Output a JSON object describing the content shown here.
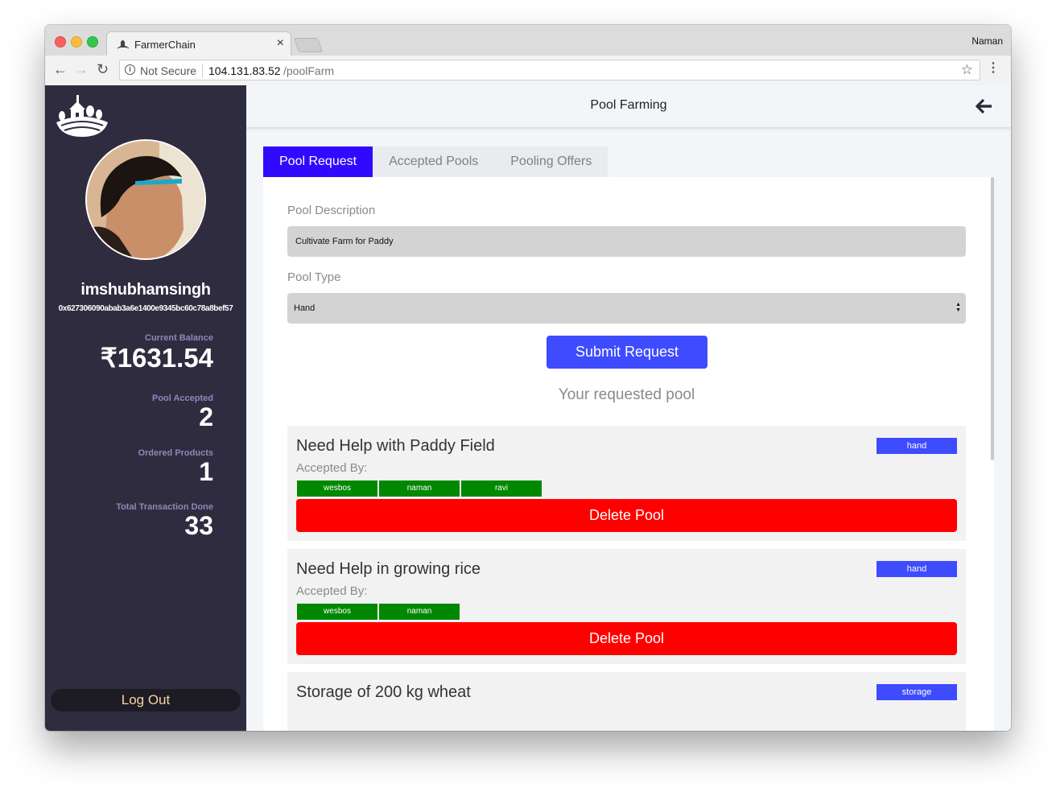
{
  "browser": {
    "tab_title": "FarmerChain",
    "profile_name": "Naman",
    "not_secure": "Not Secure",
    "url_host": "104.131.83.52",
    "url_path": "/poolFarm"
  },
  "sidebar": {
    "username": "imshubhamsingh",
    "address": "0x627306090abab3a6e1400e9345bc60c78a8bef57",
    "stats": [
      {
        "label": "Current Balance",
        "value": "₹1631.54"
      },
      {
        "label": "Pool Accepted",
        "value": "2"
      },
      {
        "label": "Ordered Products",
        "value": "1"
      },
      {
        "label": "Total Transaction Done",
        "value": "33"
      }
    ],
    "logout_label": "Log Out"
  },
  "header": {
    "title": "Pool Farming"
  },
  "tabs": [
    {
      "label": "Pool Request",
      "active": true
    },
    {
      "label": "Accepted Pools",
      "active": false
    },
    {
      "label": "Pooling Offers",
      "active": false
    }
  ],
  "form": {
    "description_label": "Pool Description",
    "description_value": "Cultivate Farm for Paddy",
    "type_label": "Pool Type",
    "type_value": "Hand",
    "submit_label": "Submit Request"
  },
  "requested_heading": "Your requested pool",
  "accepted_by_label": "Accepted By:",
  "pools": [
    {
      "title": "Need Help with Paddy Field",
      "type": "hand",
      "accepted_by": [
        "wesbos",
        "naman",
        "ravi"
      ],
      "delete_label": "Delete Pool"
    },
    {
      "title": "Need Help in growing rice",
      "type": "hand",
      "accepted_by": [
        "wesbos",
        "naman"
      ],
      "delete_label": "Delete Pool"
    },
    {
      "title": "Storage of 200 kg wheat",
      "type": "storage"
    }
  ],
  "colors": {
    "sidebar_bg": "#302c40",
    "active_tab": "#3209ff",
    "primary_button": "#3e4bff",
    "delete_button": "#ff0000",
    "acceptor_badge": "#008800"
  }
}
